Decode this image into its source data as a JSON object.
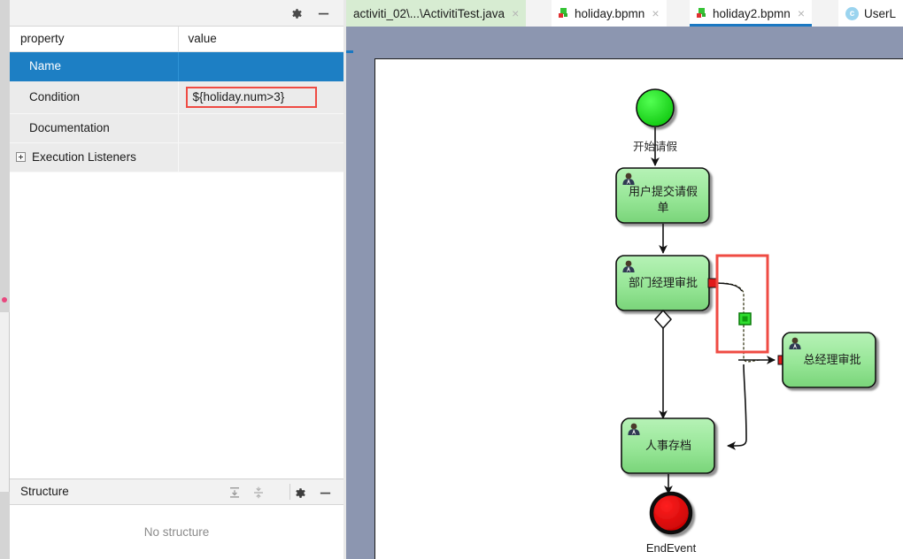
{
  "properties_panel": {
    "toolbar": {
      "gear_icon": "gear-icon",
      "minimize_icon": "minimize-icon"
    },
    "columns": [
      "property",
      "value"
    ],
    "rows": [
      {
        "property": "Name",
        "value": "",
        "selected": true,
        "expandable": false
      },
      {
        "property": "Condition",
        "value": "${holiday.num>3}",
        "selected": false,
        "expandable": false,
        "highlighted": true
      },
      {
        "property": "Documentation",
        "value": "",
        "selected": false,
        "expandable": false
      },
      {
        "property": "Execution Listeners",
        "value": "",
        "selected": false,
        "expandable": true
      }
    ]
  },
  "structure_panel": {
    "title": "Structure",
    "expand_icon": "expand-all-icon",
    "collapse_icon": "collapse-all-icon",
    "gear_icon": "gear-icon",
    "minimize_icon": "minimize-icon",
    "empty_message": "No structure"
  },
  "editor": {
    "tabs": [
      {
        "label": "activiti_02\\...\\ActivitiTest.java",
        "icon": "none",
        "state": "green",
        "close": "×"
      },
      {
        "label": "holiday.bpmn",
        "icon": "bpmn-file-icon",
        "state": "white",
        "close": "×"
      },
      {
        "label": "holiday2.bpmn",
        "icon": "bpmn-file-icon",
        "state": "active",
        "close": "×"
      },
      {
        "label": "UserL",
        "icon": "class-file-icon",
        "state": "white",
        "close": ""
      }
    ]
  },
  "diagram": {
    "type": "bpmn",
    "nodes": [
      {
        "id": "start",
        "kind": "start-event",
        "label": "开始请假",
        "label_position": "below",
        "color": "#2fdd2f"
      },
      {
        "id": "task1",
        "kind": "user-task",
        "label": "用户提交请假单",
        "color": "#90e890"
      },
      {
        "id": "task2",
        "kind": "user-task",
        "label": "部门经理审批",
        "color": "#90e890"
      },
      {
        "id": "gateway",
        "kind": "exclusive-gateway",
        "label": "",
        "color": "#ffffff"
      },
      {
        "id": "task3",
        "kind": "user-task",
        "label": "总经理审批",
        "color": "#90e890"
      },
      {
        "id": "task4",
        "kind": "user-task",
        "label": "人事存档",
        "color": "#90e890"
      },
      {
        "id": "end",
        "kind": "end-event",
        "label": "EndEvent",
        "label_position": "below",
        "color": "#e00000"
      }
    ],
    "selection": {
      "kind": "sequence-flow-selection",
      "color": "#ef4b43",
      "handle_color": "#2fdd2f"
    },
    "colors": {
      "task_fill_top": "#a8efa8",
      "task_fill_bottom": "#7fdb7f",
      "task_stroke": "#1c1c1c",
      "canvas_bg": "#ffffff",
      "editor_bg": "#8c96b0",
      "selection_red": "#ef4b43",
      "endpoint_red": "#e01b1b"
    }
  }
}
